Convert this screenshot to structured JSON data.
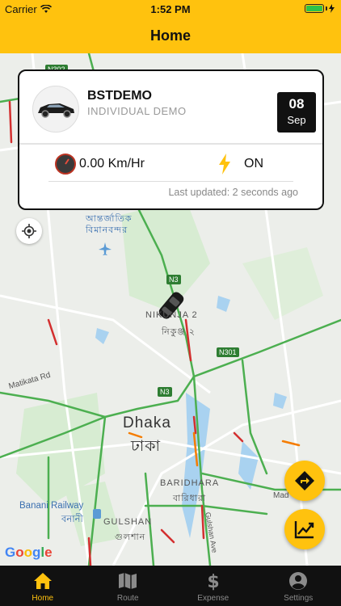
{
  "status_bar": {
    "carrier": "Carrier",
    "time": "1:52 PM"
  },
  "header": {
    "title": "Home"
  },
  "vehicle_card": {
    "name": "BSTDEMO",
    "subtitle": "INDIVIDUAL DEMO",
    "date_day": "08",
    "date_month": "Sep",
    "speed": "0.00 Km/Hr",
    "ignition": "ON",
    "last_updated": "Last updated: 2 seconds ago"
  },
  "map": {
    "labels": {
      "nikunja": "NIKUNJA 2",
      "nikunja_bn": "নিকুঞ্জ ২",
      "airport_bn": "আন্তর্জাতিক বিমানবন্দর",
      "dhaka": "Dhaka",
      "dhaka_bn": "ঢাকা",
      "baridhara": "BARIDHARA",
      "baridhara_bn": "বারিধারা",
      "gulshan": "GULSHAN",
      "gulshan_bn": "গুলশান",
      "banani_railway": "Banani Railway",
      "banani_bn": "বনানী",
      "matikata": "Matikata Rd",
      "gulshan_ave": "Gulshan Ave",
      "mad": "Mad"
    },
    "road_badges": [
      "N302",
      "N3",
      "N301",
      "N3"
    ],
    "attribution": "Google"
  },
  "tabs": [
    {
      "label": "Home",
      "icon": "home-icon",
      "active": true
    },
    {
      "label": "Route",
      "icon": "map-icon",
      "active": false
    },
    {
      "label": "Expense",
      "icon": "dollar-icon",
      "active": false
    },
    {
      "label": "Settings",
      "icon": "user-circle-icon",
      "active": false
    }
  ],
  "colors": {
    "accent": "#ffc20e",
    "tabbar": "#111111",
    "traffic_green": "#4caf50",
    "traffic_red": "#d32f2f"
  }
}
